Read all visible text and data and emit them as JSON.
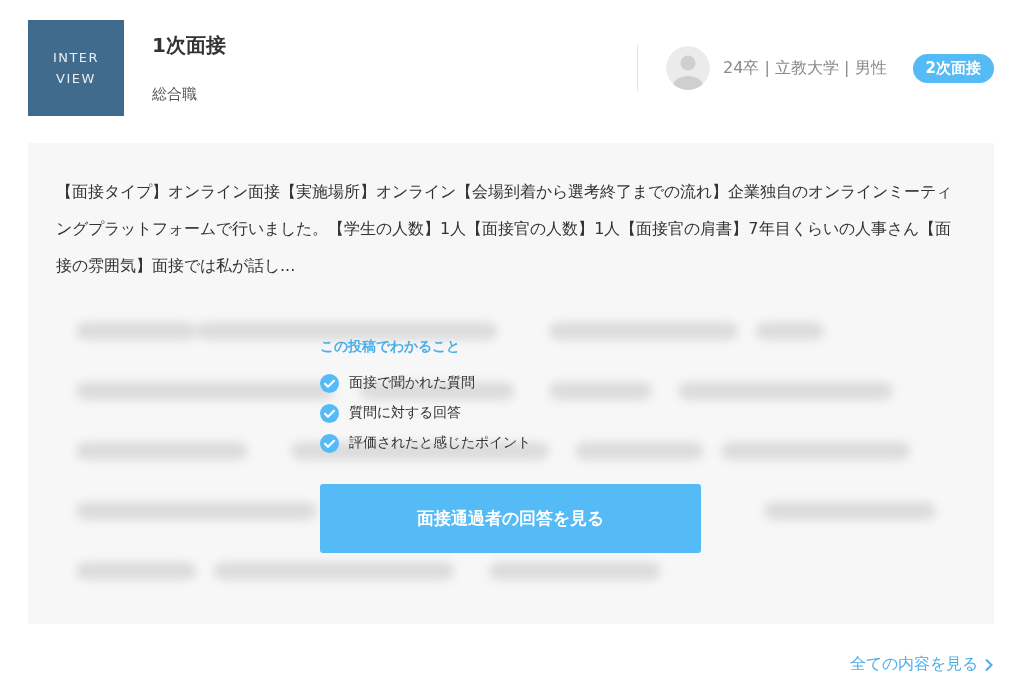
{
  "logo": {
    "lines": [
      "INTER",
      "VIEW"
    ]
  },
  "title": "1次面接",
  "subtitle": "総合職",
  "author": {
    "meta": "24卒 | 立教大学 | 男性"
  },
  "badge": "2次面接",
  "excerpt": "【面接タイプ】オンライン面接【実施場所】オンライン【会場到着から選考終了までの流れ】企業独自のオンラインミーティングプラットフォームで行いました。【学生の人数】1人【面接官の人数】1人【面接官の肩書】7年目くらいの人事さん【面接の雰囲気】面接では私が話し...",
  "locked": {
    "heading": "この投稿でわかること",
    "items": [
      "面接で聞かれた質問",
      "質問に対する回答",
      "評価されたと感じたポイント"
    ],
    "button": "面接通過者の回答を見る"
  },
  "more_link": "全ての内容を見る"
}
